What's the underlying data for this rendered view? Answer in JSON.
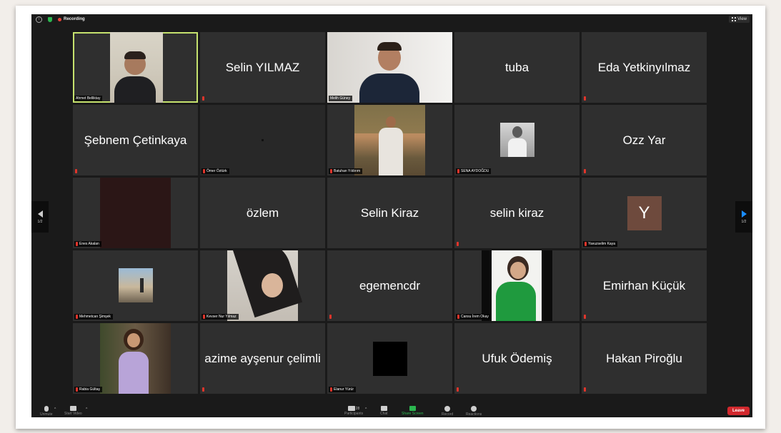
{
  "topbar": {
    "recording_label": "Recording",
    "view_label": "View"
  },
  "tiles": [
    {
      "display": "video",
      "name_label": "Ahmet Belliktay",
      "active": true
    },
    {
      "display": "name",
      "name": "Selin YILMAZ"
    },
    {
      "display": "video",
      "name_label": "Melih Güney"
    },
    {
      "display": "name",
      "name": "tuba"
    },
    {
      "display": "name",
      "name": "Eda Yetkinyılmaz"
    },
    {
      "display": "name",
      "name": "Şebnem Çetinkaya"
    },
    {
      "display": "video",
      "name_label": "Ömer Öztürk"
    },
    {
      "display": "video",
      "name_label": "Batuhan Yıldırım"
    },
    {
      "display": "photo",
      "name_label": "SENA AYDOĞDU"
    },
    {
      "display": "name",
      "name": "Ozz Yar"
    },
    {
      "display": "video",
      "name_label": "Enes Akalan"
    },
    {
      "display": "name",
      "name": "özlem"
    },
    {
      "display": "name",
      "name": "Selin Kiraz"
    },
    {
      "display": "name",
      "name": "selin kiraz"
    },
    {
      "display": "avatar",
      "avatar_letter": "Y",
      "name_label": "Yavuzselim Kaya"
    },
    {
      "display": "photo",
      "name_label": "Mehmetcan Şimşek"
    },
    {
      "display": "video",
      "name_label": "Kevser Nur Yılmaz"
    },
    {
      "display": "name",
      "name": "egemencdr"
    },
    {
      "display": "video",
      "name_label": "Cansu İrem Okay"
    },
    {
      "display": "name",
      "name": "Emirhan Küçük"
    },
    {
      "display": "video",
      "name_label": "Rabia Gültaş"
    },
    {
      "display": "name",
      "name": "azime ayşenur çelimli"
    },
    {
      "display": "video",
      "name_label": "Elanur Yürür"
    },
    {
      "display": "name",
      "name": "Ufuk Ödemiş"
    },
    {
      "display": "name",
      "name": "Hakan Piroğlu"
    }
  ],
  "pagination": {
    "left_page": "1/2",
    "right_page": "1/2"
  },
  "toolbar": {
    "items": [
      {
        "label": "Unmute"
      },
      {
        "label": "Start Video"
      },
      {
        "label": "Participants",
        "count": "28"
      },
      {
        "label": "Chat"
      },
      {
        "label": "Share Screen"
      },
      {
        "label": "Record"
      },
      {
        "label": "Reactions"
      }
    ],
    "leave_label": "Leave"
  },
  "colors": {
    "active_border": "#c6e26e",
    "leave": "#d1282d",
    "share": "#2bb64f",
    "nav_arrow": "#1a8cff"
  }
}
